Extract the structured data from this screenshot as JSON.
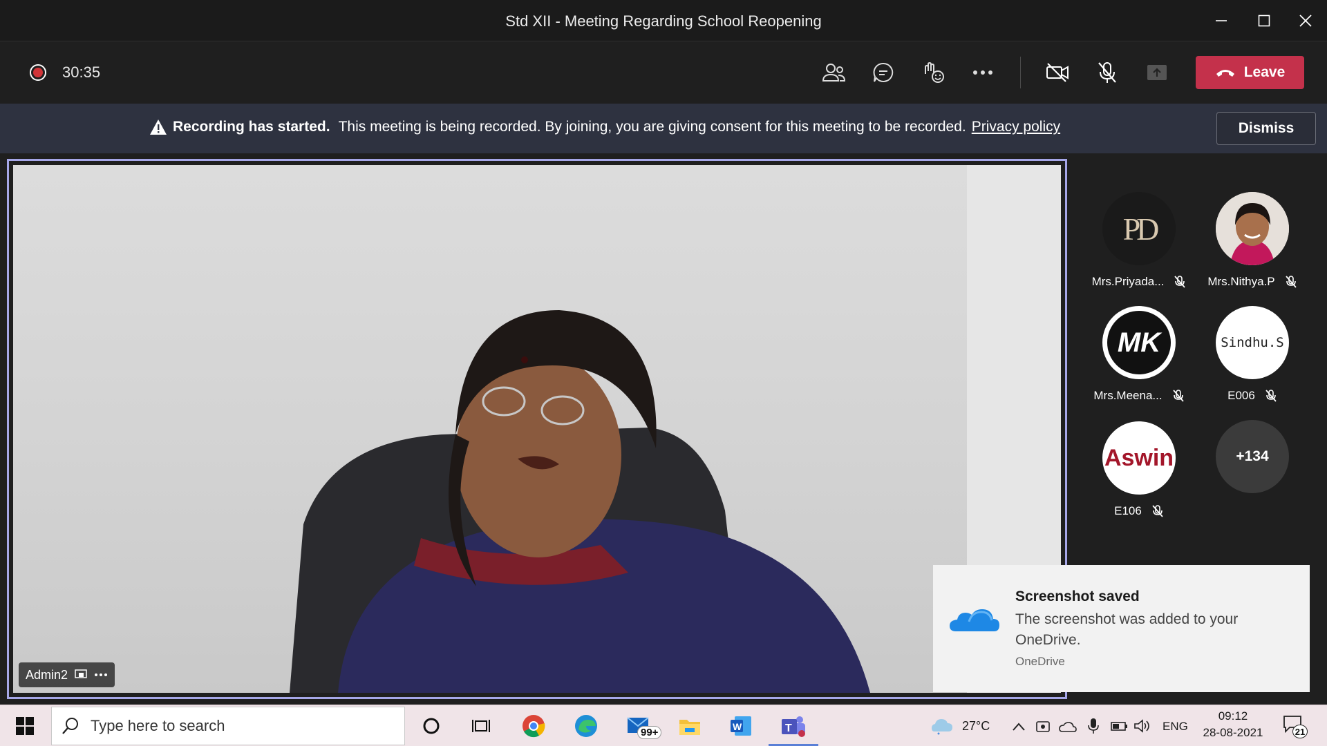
{
  "window": {
    "title": "Std XII - Meeting Regarding School Reopening",
    "minimize_icon": "minimize-icon",
    "maximize_icon": "maximize-icon",
    "close_icon": "close-icon"
  },
  "controls": {
    "timer": "30:35",
    "leave_label": "Leave",
    "icons": [
      "participants-icon",
      "chat-icon",
      "reactions-icon",
      "more-icon",
      "camera-off-icon",
      "mic-off-icon",
      "share-icon"
    ]
  },
  "banner": {
    "bold_text": "Recording has started.",
    "message": "This meeting is being recorded. By joining, you are giving consent for this meeting to be recorded.",
    "link_text": "Privacy policy",
    "dismiss_label": "Dismiss"
  },
  "stage": {
    "speaker_name": "Admin2"
  },
  "participants": [
    {
      "label": "Mrs.Priyada...",
      "avatar_text": "PD",
      "muted": true
    },
    {
      "label": "Mrs.Nithya.P",
      "avatar_text": "",
      "muted": true
    },
    {
      "label": "Mrs.Meena...",
      "avatar_text": "MK",
      "muted": true
    },
    {
      "label": "E006",
      "avatar_text": "Sindhu.S",
      "muted": true
    },
    {
      "label": "E106",
      "avatar_text": "Aswin",
      "muted": true
    }
  ],
  "overflow_count": "+134",
  "toast": {
    "title": "Screenshot saved",
    "body": "The screenshot was added to your OneDrive.",
    "source": "OneDrive"
  },
  "taskbar": {
    "search_placeholder": "Type here to search",
    "mail_badge": "99+",
    "weather": "27°C",
    "language": "ENG",
    "time": "09:12",
    "date": "28-08-2021",
    "notification_count": "21"
  },
  "colors": {
    "leave": "#c4314b",
    "stage_border": "#a6a7e8",
    "banner_bg": "#2e3240",
    "record": "#d13438"
  }
}
